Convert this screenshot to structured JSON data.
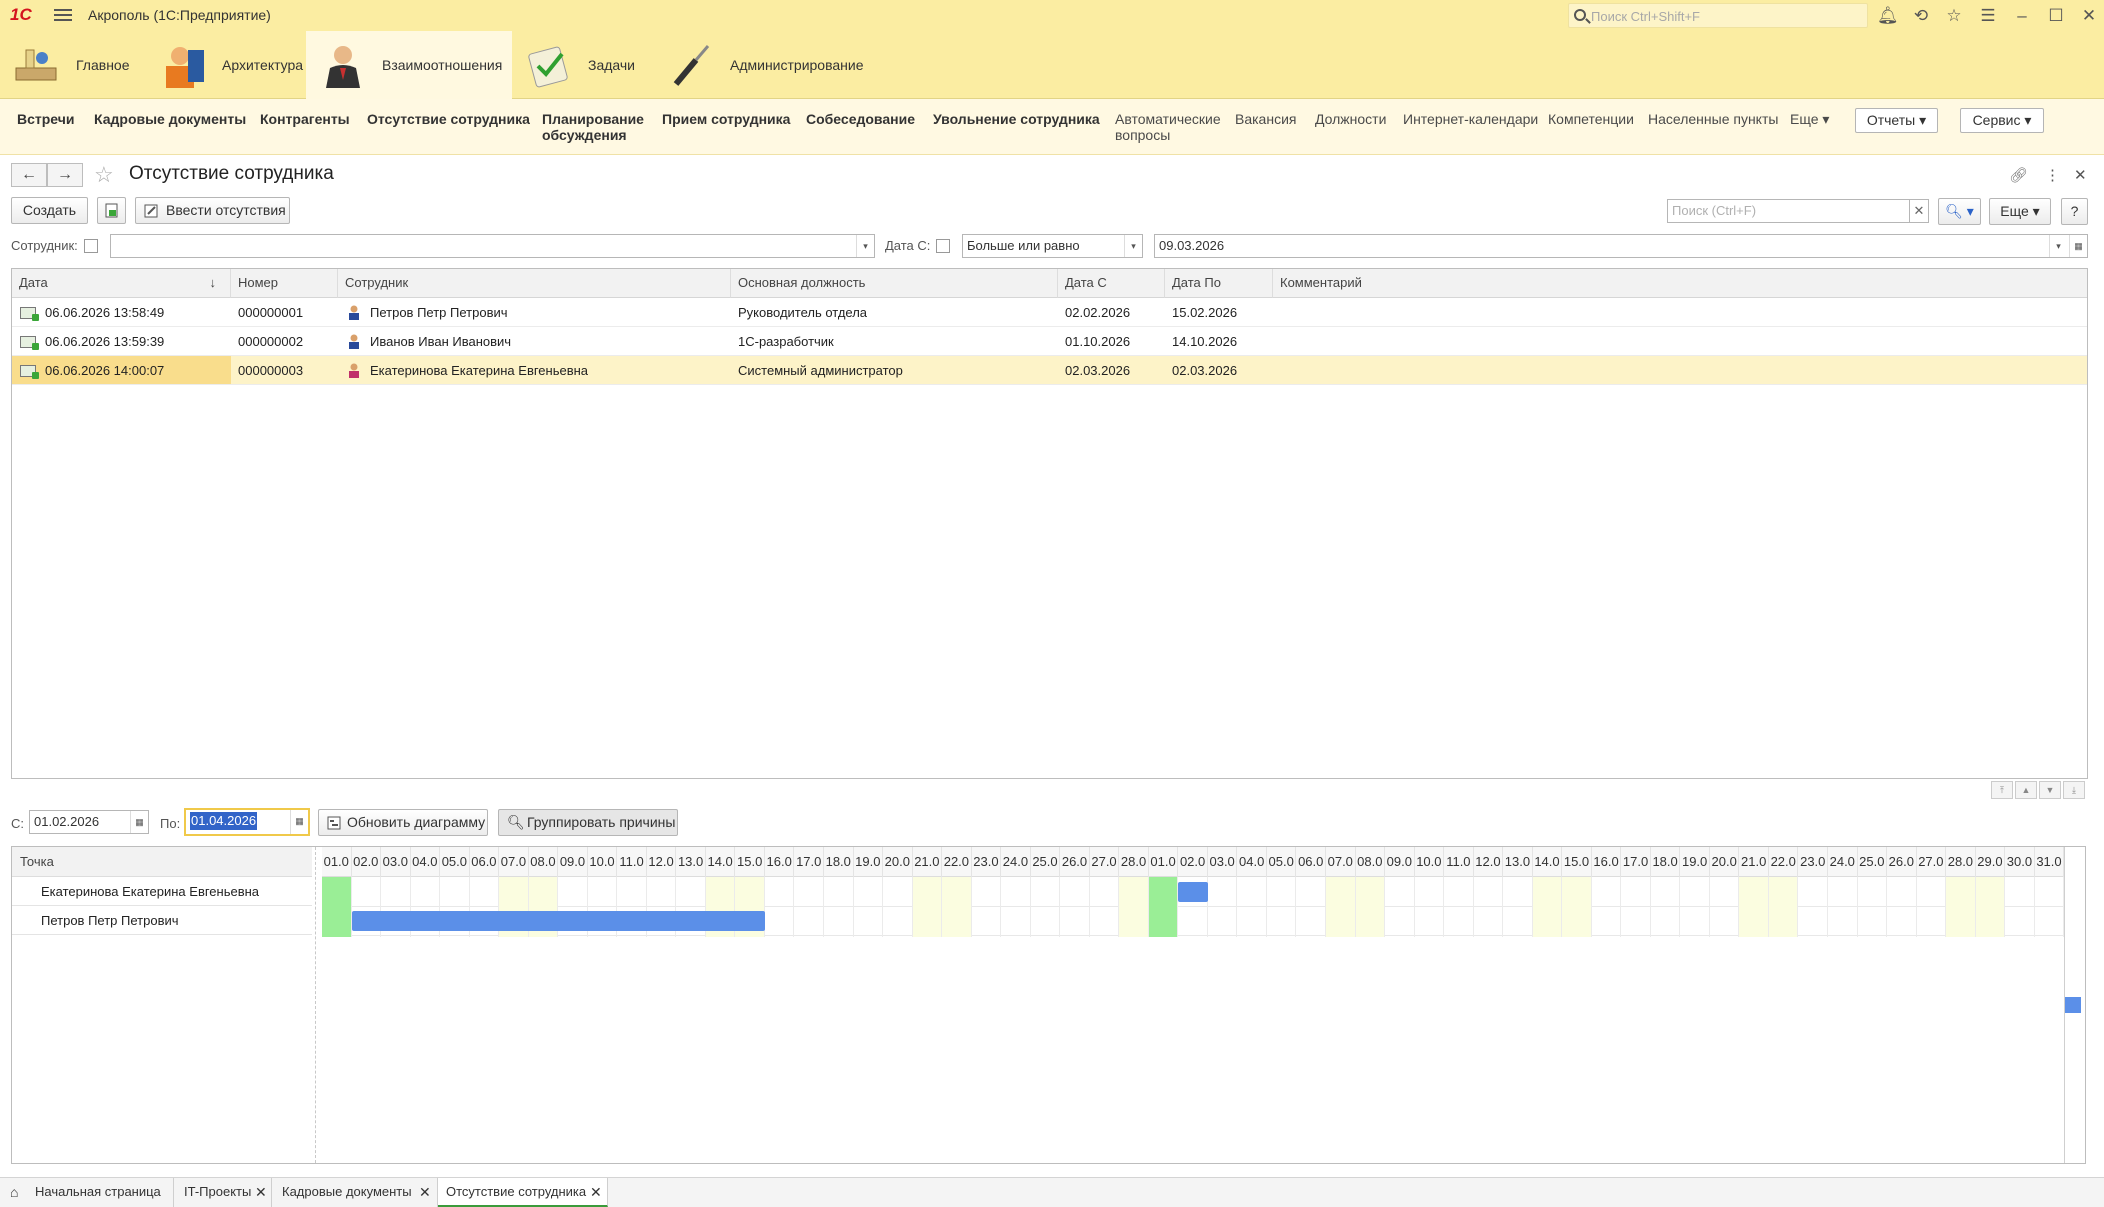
{
  "titlebar": {
    "logo": "1С",
    "app_title": "Акрополь  (1С:Предприятие)",
    "search_placeholder": "Поиск Ctrl+Shift+F"
  },
  "sections": [
    {
      "label": "Главное"
    },
    {
      "label": "Архитектура"
    },
    {
      "label": "Взаимоотношения"
    },
    {
      "label": "Задачи"
    },
    {
      "label": "Администрирование"
    }
  ],
  "functions": {
    "bold": [
      "Встречи",
      "Кадровые документы",
      "Контрагенты",
      "Отсутствие сотрудника",
      "Планирование",
      "обсуждения",
      "Прием сотрудника",
      "Собеседование",
      "Увольнение сотрудника"
    ],
    "regular": [
      "Автоматические",
      "вопросы",
      "Вакансия",
      "Должности",
      "Интернет-календари",
      "Компетенции",
      "Населенные пункты",
      "Еще"
    ],
    "reports_btn": "Отчеты",
    "service_btn": "Сервис"
  },
  "form": {
    "title": "Отсутствие сотрудника",
    "create_btn": "Создать",
    "enter_btn": "Ввести отсутствия",
    "search_placeholder": "Поиск (Ctrl+F)",
    "more_btn": "Еще",
    "help_btn": "?",
    "filter": {
      "employee_label": "Сотрудник:",
      "date_label": "Дата С:",
      "condition": "Больше или равно",
      "date_value": "09.03.2026"
    }
  },
  "table": {
    "columns": [
      "Дата",
      "Номер",
      "Сотрудник",
      "Основная должность",
      "Дата С",
      "Дата По",
      "Комментарий"
    ],
    "rows": [
      {
        "date": "06.06.2026 13:58:49",
        "number": "000000001",
        "employee": "Петров Петр Петрович",
        "position": "Руководитель отдела",
        "from": "02.02.2026",
        "to": "15.02.2026",
        "comment": ""
      },
      {
        "date": "06.06.2026 13:59:39",
        "number": "000000002",
        "employee": "Иванов Иван Иванович",
        "position": "1С-разработчик",
        "from": "01.10.2026",
        "to": "14.10.2026",
        "comment": ""
      },
      {
        "date": "06.06.2026 14:00:07",
        "number": "000000003",
        "employee": "Екатеринова Екатерина Евгеньевна",
        "position": "Системный администратор",
        "from": "02.03.2026",
        "to": "02.03.2026",
        "comment": ""
      }
    ]
  },
  "diagram": {
    "from_label": "С:",
    "from_value": "01.02.2026",
    "to_label": "По:",
    "to_value": "01.04.2026",
    "refresh_btn": "Обновить диаграмму",
    "group_btn": "Группировать причины",
    "point_header": "Точка",
    "rows": [
      "Екатеринова Екатерина Евгеньевна",
      "Петров Петр Петрович"
    ],
    "days": [
      "01.0",
      "02.0",
      "03.0",
      "04.0",
      "05.0",
      "06.0",
      "07.0",
      "08.0",
      "09.0",
      "10.0",
      "11.0",
      "12.0",
      "13.0",
      "14.0",
      "15.0",
      "16.0",
      "17.0",
      "18.0",
      "19.0",
      "20.0",
      "21.0",
      "22.0",
      "23.0",
      "24.0",
      "25.0",
      "26.0",
      "27.0",
      "28.0",
      "01.0",
      "02.0",
      "03.0",
      "04.0",
      "05.0",
      "06.0",
      "07.0",
      "08.0",
      "09.0",
      "10.0",
      "11.0",
      "12.0",
      "13.0",
      "14.0",
      "15.0",
      "16.0",
      "17.0",
      "18.0",
      "19.0",
      "20.0",
      "21.0",
      "22.0",
      "23.0",
      "24.0",
      "25.0",
      "26.0",
      "27.0",
      "28.0",
      "29.0",
      "30.0",
      "31.0"
    ],
    "weekend_color": "#fbfde0",
    "today_color": "#9aee96",
    "bar_color": "#5b8fe8"
  },
  "tabs": [
    {
      "label": "Начальная страница"
    },
    {
      "label": "IT-Проекты"
    },
    {
      "label": "Кадровые документы"
    },
    {
      "label": "Отсутствие сотрудника"
    }
  ]
}
